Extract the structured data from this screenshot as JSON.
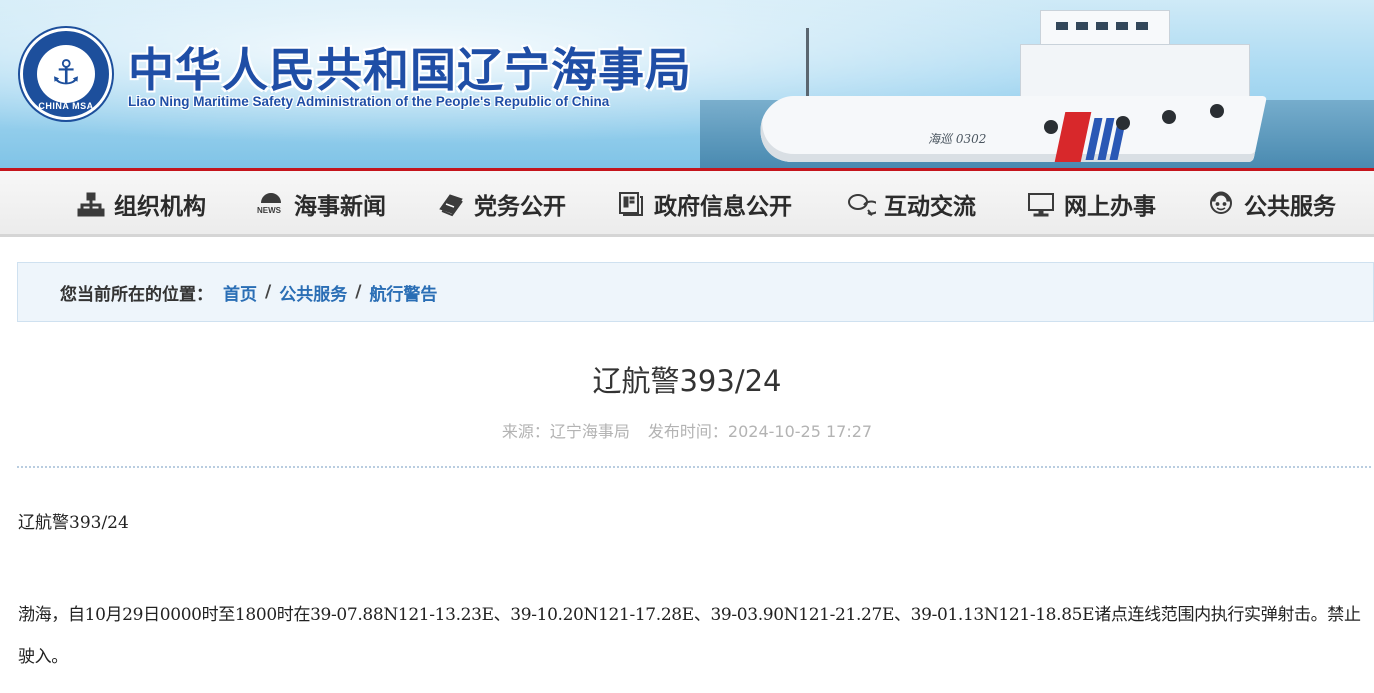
{
  "header": {
    "title_cn": "中华人民共和国辽宁海事局",
    "title_en": "Liao Ning Maritime Safety Administration of the People's Republic of China",
    "logo_text": "CHINA MSA",
    "ship_name": "海巡 0302",
    "brand_blue": "#1f4ea6",
    "accent_red": "#c5161d"
  },
  "nav": {
    "items": [
      {
        "label": "组织机构",
        "icon": "org-chart-icon"
      },
      {
        "label": "海事新闻",
        "icon": "news-icon"
      },
      {
        "label": "党务公开",
        "icon": "book-icon"
      },
      {
        "label": "政府信息公开",
        "icon": "document-icon"
      },
      {
        "label": "互动交流",
        "icon": "chat-icon"
      },
      {
        "label": "网上办事",
        "icon": "monitor-icon"
      },
      {
        "label": "公共服务",
        "icon": "service-person-icon"
      }
    ]
  },
  "breadcrumb": {
    "prefix": "您当前所在的位置：",
    "items": [
      "首页",
      "公共服务",
      "航行警告"
    ],
    "separator": "/"
  },
  "article": {
    "title": "辽航警393/24",
    "source_label": "来源：辽宁海事局",
    "time_label": "发布时间：2024-10-25 17:27",
    "body_heading": "辽航警393/24",
    "body_paragraph": "渤海，自10月29日0000时至1800时在39-07.88N121-13.23E、39-10.20N121-17.28E、39-03.90N121-21.27E、39-01.13N121-18.85E诸点连线范围内执行实弹射击。禁止驶入。"
  }
}
